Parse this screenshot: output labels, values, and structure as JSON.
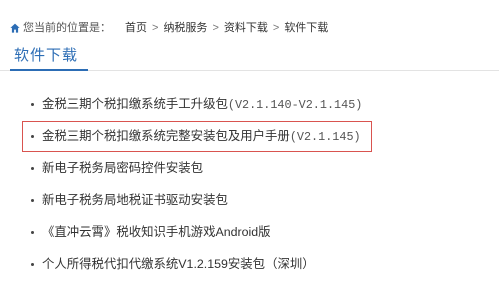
{
  "breadcrumb": {
    "prefix": "您当前的位置是：",
    "separator": ">",
    "items": [
      "首页",
      "纳税服务",
      "资料下载",
      "软件下载"
    ]
  },
  "section": {
    "title": "软件下载"
  },
  "downloads": [
    {
      "title": "金税三期个税扣缴系统手工升级包",
      "version": "(V2.1.140-V2.1.145)"
    },
    {
      "title": "金税三期个税扣缴系统完整安装包及用户手册",
      "version": "(V2.1.145)",
      "highlighted": true
    },
    {
      "title": "新电子税务局密码控件安装包"
    },
    {
      "title": "新电子税务局地税证书驱动安装包"
    },
    {
      "title": "《直冲云霄》税收知识手机游戏Android版"
    },
    {
      "title": "个人所得税代扣代缴系统V1.2.159安装包（深圳）"
    }
  ],
  "icons": {
    "breadcrumb": "home-icon",
    "list_marker": "bullet-dot"
  },
  "colors": {
    "accent": "#2c6db5",
    "text": "#333333",
    "highlight": "#d9534f",
    "divider": "#e3e3e3"
  }
}
